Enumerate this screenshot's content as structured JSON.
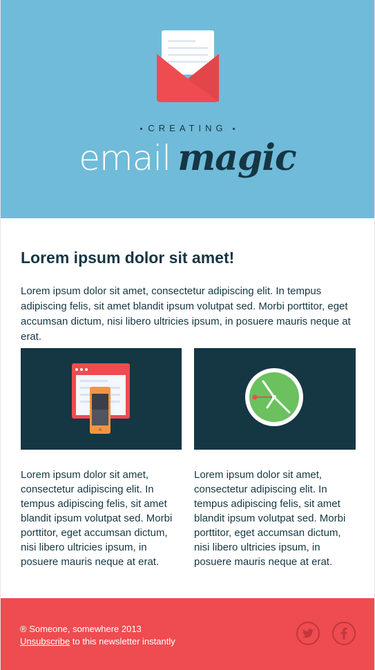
{
  "header": {
    "tagline": "CREATING",
    "brand_email": "email",
    "brand_magic": "magic",
    "bg_color": "#70bbd9",
    "icon": "envelope-icon"
  },
  "main": {
    "heading": "Lorem ipsum dolor sit amet!",
    "intro": "Lorem ipsum dolor sit amet, consectetur adipiscing elit. In tempus adipiscing felis, sit amet blandit ipsum volutpat sed. Morbi porttitor, eget accumsan dictum, nisi libero ultricies ipsum, in posuere mauris neque at erat.",
    "columns": [
      {
        "icon": "devices-icon",
        "text": "Lorem ipsum dolor sit amet, consectetur adipiscing elit. In tempus adipiscing felis, sit amet blandit ipsum volutpat sed. Morbi porttitor, eget accumsan dictum, nisi libero ultricies ipsum, in posuere mauris neque at erat."
      },
      {
        "icon": "clock-icon",
        "text": "Lorem ipsum dolor sit amet, consectetur adipiscing elit. In tempus adipiscing felis, sit amet blandit ipsum volutpat sed. Morbi porttitor, eget accumsan dictum, nisi libero ultricies ipsum, in posuere mauris neque at erat."
      }
    ]
  },
  "footer": {
    "copyright": "® Someone, somewhere 2013",
    "unsubscribe_link": "Unsubscribe",
    "unsubscribe_suffix": " to this newsletter instantly",
    "bg_color": "#ee4c50",
    "social": [
      "twitter-icon",
      "facebook-icon"
    ]
  }
}
